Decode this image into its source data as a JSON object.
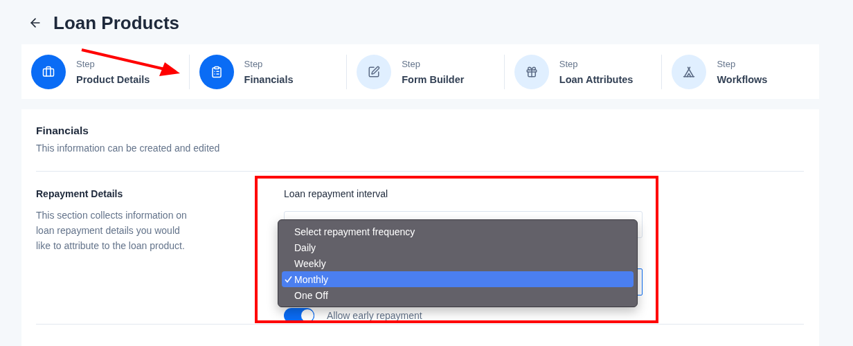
{
  "page": {
    "title": "Loan Products"
  },
  "steps": [
    {
      "caption": "Step",
      "label": "Product Details",
      "kind": "briefcase",
      "done": true
    },
    {
      "caption": "Step",
      "label": "Financials",
      "kind": "clipboard",
      "done": true
    },
    {
      "caption": "Step",
      "label": "Form Builder",
      "kind": "pencil",
      "done": false
    },
    {
      "caption": "Step",
      "label": "Loan Attributes",
      "kind": "gift",
      "done": false
    },
    {
      "caption": "Step",
      "label": "Workflows",
      "kind": "tent",
      "done": false
    }
  ],
  "card": {
    "title": "Financials",
    "subtitle": "This information can be created and edited"
  },
  "section": {
    "title": "Repayment Details",
    "description": "This section collects information on loan repayment details you would like to attribute to the loan product."
  },
  "field": {
    "label": "Loan repayment interval"
  },
  "dropdown": {
    "options": [
      {
        "label": "Select repayment frequency",
        "selected": false
      },
      {
        "label": "Daily",
        "selected": false
      },
      {
        "label": "Weekly",
        "selected": false
      },
      {
        "label": "Monthly",
        "selected": true
      },
      {
        "label": "One Off",
        "selected": false
      }
    ]
  },
  "toggle": {
    "label": "Allow early repayment",
    "on": true
  }
}
